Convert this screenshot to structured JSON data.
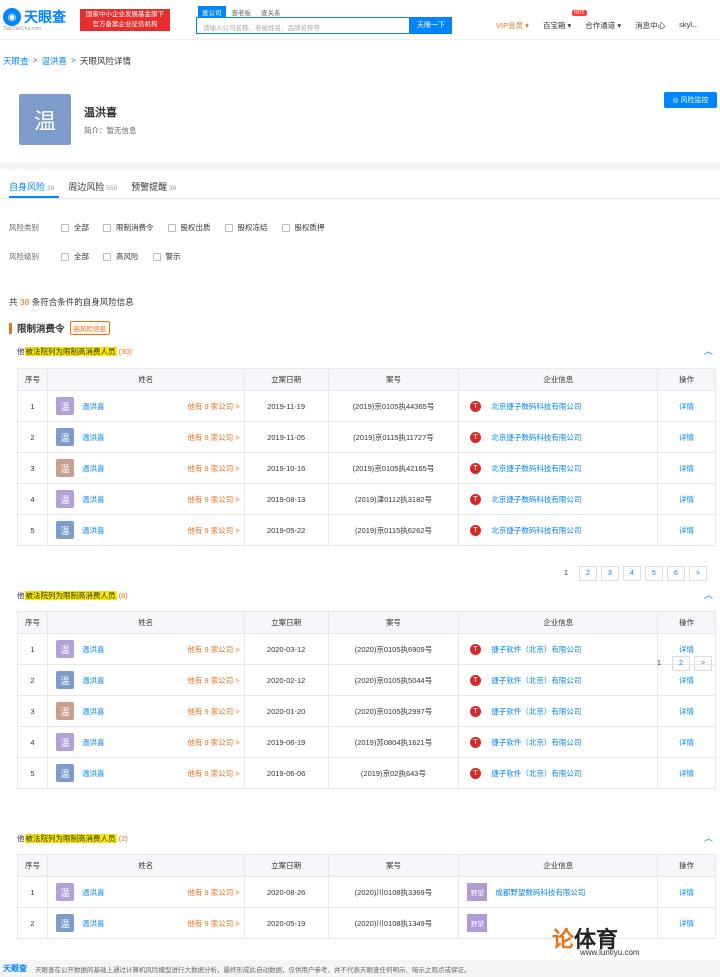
{
  "header": {
    "logo_text": "天眼查",
    "logo_sub": "TianYanCha.com",
    "promo_line1": "国家中小企业发展基金旗下",
    "promo_line2": "官方备案企业征信机构",
    "search_tabs": [
      "查公司",
      "查老板",
      "查关系"
    ],
    "search_placeholder": "请输入公司名称、老板姓名、品牌名称等",
    "search_button": "天眼一下",
    "nav": [
      "VIP会员 ▾",
      "百宝箱 ▾",
      "合作通道 ▾",
      "消息中心",
      "skyl..."
    ],
    "hot": "HOT"
  },
  "breadcrumb": [
    "天眼查",
    "温洪喜",
    "天眼风险详情"
  ],
  "person": {
    "avatar_char": "温",
    "name": "温洪喜",
    "intro": "简介：暂无信息",
    "monitor_label": "风险监控"
  },
  "tabs": [
    {
      "label": "自身风险",
      "count": "38"
    },
    {
      "label": "周边风险",
      "count": "559"
    },
    {
      "label": "预警提醒",
      "count": "38"
    }
  ],
  "filters": {
    "risk_type_label": "风险类别",
    "risk_types": [
      "全部",
      "限制消费令",
      "股权出质",
      "股权冻结",
      "股权质押"
    ],
    "risk_level_label": "风险级别",
    "risk_levels": [
      "全部",
      "高风险",
      "警示"
    ]
  },
  "summary": {
    "prefix": "共",
    "count": "38",
    "suffix": "条符合条件的自身风险信息"
  },
  "section": {
    "title": "限制消费令",
    "badge": "高风险信息"
  },
  "table_headers": [
    "序号",
    "姓名",
    "立案日期",
    "案号",
    "企业信息",
    "操作"
  ],
  "row_common": {
    "other_link": "他有 9 家公司 >",
    "detail": "详情"
  },
  "groups": [
    {
      "prefix": "他",
      "highlight": "被法院列为限制高消费人员",
      "count": "(30)",
      "rows": [
        {
          "no": "1",
          "name": "温洪喜",
          "date": "2019-11-19",
          "case": "(2019)京0105执44365号",
          "company": "北京捷子数码科技有限公司"
        },
        {
          "no": "2",
          "name": "温洪喜",
          "date": "2019-11-05",
          "case": "(2019)京0115执11727号",
          "company": "北京捷子数码科技有限公司"
        },
        {
          "no": "3",
          "name": "温洪喜",
          "date": "2019-10-16",
          "case": "(2019)京0105执42165号",
          "company": "北京捷子数码科技有限公司"
        },
        {
          "no": "4",
          "name": "温洪喜",
          "date": "2019-08-13",
          "case": "(2019)津0112执3182号",
          "company": "北京捷子数码科技有限公司"
        },
        {
          "no": "5",
          "name": "温洪喜",
          "date": "2019-05-22",
          "case": "(2019)京0115执6262号",
          "company": "北京捷子数码科技有限公司"
        }
      ],
      "pager": [
        "1",
        "2",
        "3",
        "4",
        "5",
        "6",
        ">"
      ]
    },
    {
      "prefix": "他",
      "highlight": "被法院列为限制高消费人员",
      "count": "(6)",
      "rows": [
        {
          "no": "1",
          "name": "温洪喜",
          "date": "2020-03-12",
          "case": "(2020)京0105执6909号",
          "company": "捷子软件（北京）有限公司"
        },
        {
          "no": "2",
          "name": "温洪喜",
          "date": "2020-02-12",
          "case": "(2020)京0105执5044号",
          "company": "捷子软件（北京）有限公司"
        },
        {
          "no": "3",
          "name": "温洪喜",
          "date": "2020-01-20",
          "case": "(2020)京0105执2997号",
          "company": "捷子软件（北京）有限公司"
        },
        {
          "no": "4",
          "name": "温洪喜",
          "date": "2019-06-19",
          "case": "(2019)苏0804执1621号",
          "company": "捷子软件（北京）有限公司"
        },
        {
          "no": "5",
          "name": "温洪喜",
          "date": "2019-06-06",
          "case": "(2019)京02执643号",
          "company": "捷子软件（北京）有限公司"
        }
      ],
      "pager": [
        "1",
        "2",
        ">"
      ]
    },
    {
      "prefix": "他",
      "highlight": "被法院列为限制高消费人员",
      "count": "(2)",
      "rows": [
        {
          "no": "1",
          "name": "温洪喜",
          "date": "2020-08-26",
          "case": "(2020)川0108执3369号",
          "company": "成都野望数码科技有限公司"
        },
        {
          "no": "2",
          "name": "温洪喜",
          "date": "2020-05-19",
          "case": "(2020)川0108执1349号",
          "company": ""
        }
      ],
      "pager": []
    }
  ],
  "company_logo_label": "野望",
  "footer": {
    "logo": "天眼查",
    "text": "天眼查在公开数据的基础上通过计算机风险模型进行大数据分析，最终形成此自动数据，仅供用户参考，并不代表天眼查任何明示、暗示之观点或保证。"
  },
  "watermark": {
    "main_a": "论",
    "main_b": "体育",
    "url": "www.luntiyu.com"
  },
  "colors": {
    "brand": "#0084ff",
    "accent": "#e8731b",
    "highlight": "#f9e900"
  }
}
